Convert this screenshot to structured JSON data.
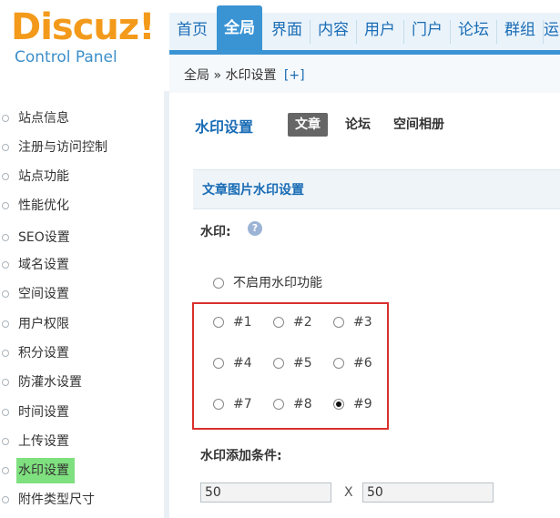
{
  "logo": {
    "main": "Discuz!",
    "sub": "Control Panel"
  },
  "nav": {
    "items": [
      {
        "label": "首页",
        "active": false
      },
      {
        "label": "全局",
        "active": true
      },
      {
        "label": "界面",
        "active": false
      },
      {
        "label": "内容",
        "active": false
      },
      {
        "label": "用户",
        "active": false
      },
      {
        "label": "门户",
        "active": false
      },
      {
        "label": "论坛",
        "active": false
      },
      {
        "label": "群组",
        "active": false
      },
      {
        "label": "运",
        "active": false
      }
    ]
  },
  "breadcrumb": {
    "path": "全局 » 水印设置",
    "plus": "[+]"
  },
  "sidebar": {
    "items": [
      {
        "label": "站点信息"
      },
      {
        "label": "注册与访问控制"
      },
      {
        "label": "站点功能"
      },
      {
        "label": "性能优化"
      },
      {
        "label": "SEO设置"
      },
      {
        "label": "域名设置"
      },
      {
        "label": "空间设置"
      },
      {
        "label": "用户权限"
      },
      {
        "label": "积分设置"
      },
      {
        "label": "防灌水设置"
      },
      {
        "label": "时间设置"
      },
      {
        "label": "上传设置"
      },
      {
        "label": "水印设置",
        "active": true
      },
      {
        "label": "附件类型尺寸"
      }
    ]
  },
  "main": {
    "title": "水印设置",
    "tabs": [
      {
        "label": "文章",
        "active": true
      },
      {
        "label": "论坛",
        "active": false
      },
      {
        "label": "空间相册",
        "active": false
      }
    ],
    "section_title": "文章图片水印设置",
    "watermark_label": "水印:",
    "help_icon": "?",
    "disable_option": "不启用水印功能",
    "positions": [
      "#1",
      "#2",
      "#3",
      "#4",
      "#5",
      "#6",
      "#7",
      "#8",
      "#9"
    ],
    "selected_position": "#9",
    "condition_label": "水印添加条件:",
    "width_value": "50",
    "height_value": "50",
    "x_sep": "X"
  }
}
